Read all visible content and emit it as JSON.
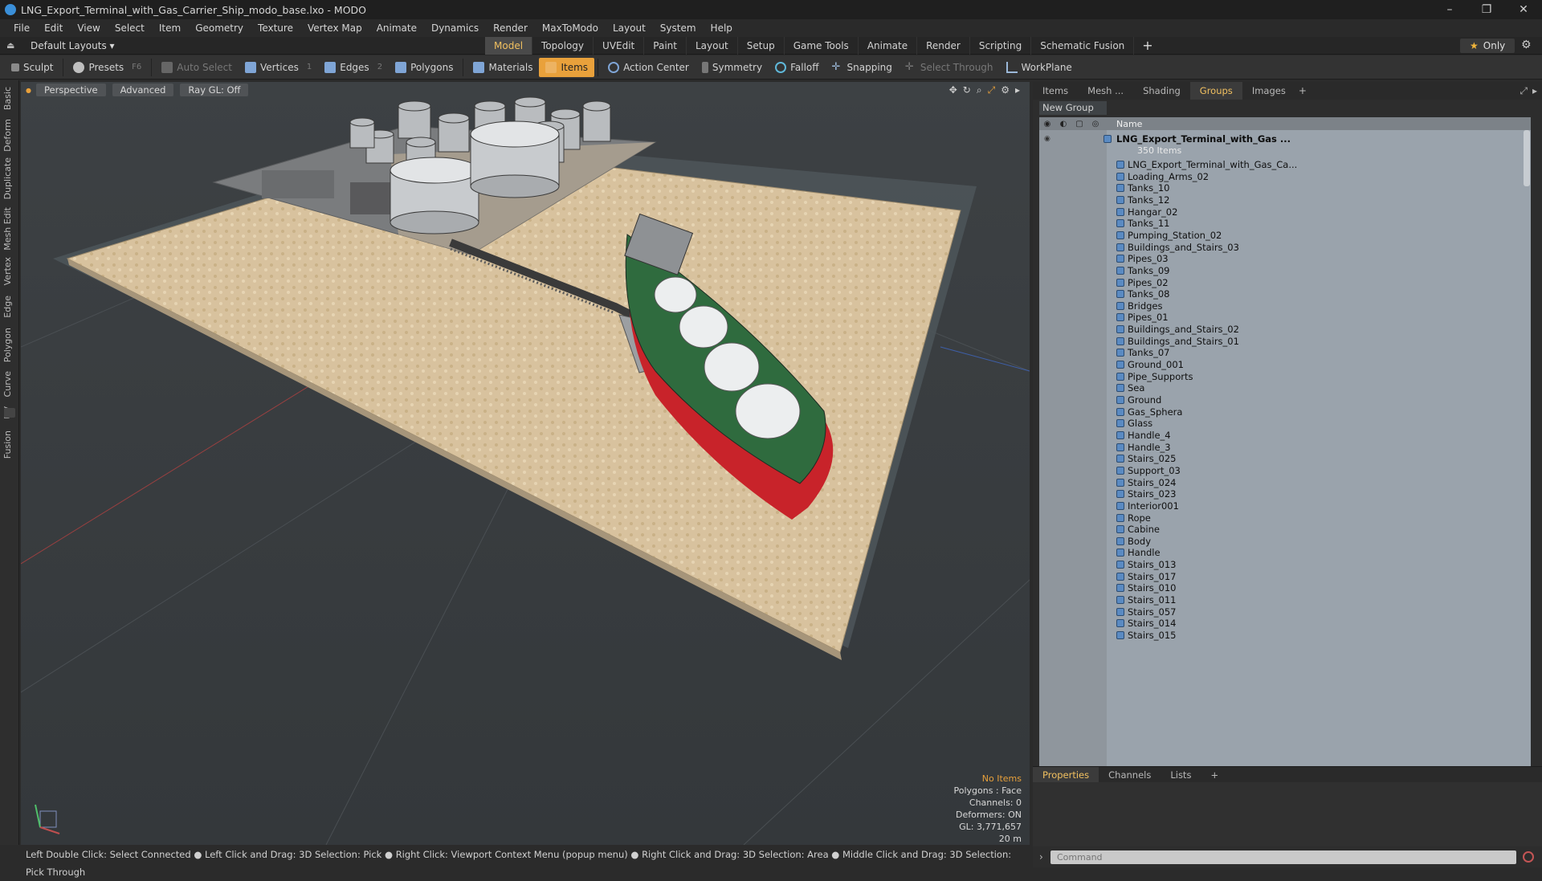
{
  "window": {
    "title": "LNG_Export_Terminal_with_Gas_Carrier_Ship_modo_base.lxo - MODO",
    "controls": [
      "–",
      "❐",
      "✕"
    ]
  },
  "menu": [
    "File",
    "Edit",
    "View",
    "Select",
    "Item",
    "Geometry",
    "Texture",
    "Vertex Map",
    "Animate",
    "Dynamics",
    "Render",
    "MaxToModo",
    "Layout",
    "System",
    "Help"
  ],
  "layout": {
    "dropdown": "Default Layouts ▾",
    "tabs": [
      "Model",
      "Topology",
      "UVEdit",
      "Paint",
      "Layout",
      "Setup",
      "Game Tools",
      "Animate",
      "Render",
      "Scripting",
      "Schematic Fusion"
    ],
    "active_tab": "Model",
    "plus": "+",
    "only_label": "Only"
  },
  "toolbar": {
    "sculpt": "Sculpt",
    "presets": "Presets",
    "presets_key": "F6",
    "auto_select": "Auto Select",
    "vertices": "Vertices",
    "vertices_key": "1",
    "edges": "Edges",
    "edges_key": "2",
    "polygons": "Polygons",
    "materials": "Materials",
    "items": "Items",
    "action_center": "Action Center",
    "symmetry": "Symmetry",
    "falloff": "Falloff",
    "snapping": "Snapping",
    "select_through": "Select Through",
    "workplane": "WorkPlane"
  },
  "left_tabs": [
    "Basic",
    "Deform",
    "Duplicate",
    "Mesh Edit",
    "Vertex",
    "Edge",
    "Polygon",
    "Curve",
    "UV",
    "Fusion"
  ],
  "viewport": {
    "perspective": "Perspective",
    "advanced": "Advanced",
    "raygl": "Ray GL: Off",
    "stats": {
      "no_items": "No Items",
      "polygons": "Polygons : Face",
      "channels": "Channels: 0",
      "deformers": "Deformers: ON",
      "gl": "GL: 3,771,657",
      "scale": "20 m"
    }
  },
  "statusbar": "Left Double Click: Select Connected ● Left Click and Drag: 3D Selection: Pick ● Right Click: Viewport Context Menu (popup menu) ● Right Click and Drag: 3D Selection: Area ● Middle Click and Drag: 3D Selection: Pick Through",
  "panel": {
    "tabs": [
      "Items",
      "Mesh ...",
      "Shading",
      "Groups",
      "Images"
    ],
    "active_tab": "Groups",
    "new_group": "New Group",
    "column_name": "Name",
    "root_label": "LNG_Export_Terminal_with_Gas ...",
    "root_count": "350 Items",
    "items": [
      "LNG_Export_Terminal_with_Gas_Ca...",
      "Loading_Arms_02",
      "Tanks_10",
      "Tanks_12",
      "Hangar_02",
      "Tanks_11",
      "Pumping_Station_02",
      "Buildings_and_Stairs_03",
      "Pipes_03",
      "Tanks_09",
      "Pipes_02",
      "Tanks_08",
      "Bridges",
      "Pipes_01",
      "Buildings_and_Stairs_02",
      "Buildings_and_Stairs_01",
      "Tanks_07",
      "Ground_001",
      "Pipe_Supports",
      "Sea",
      "Ground",
      "Gas_Sphera",
      "Glass",
      "Handle_4",
      "Handle_3",
      "Stairs_025",
      "Support_03",
      "Stairs_024",
      "Stairs_023",
      "Interior001",
      "Rope",
      "Cabine",
      "Body",
      "Handle",
      "Stairs_013",
      "Stairs_017",
      "Stairs_010",
      "Stairs_011",
      "Stairs_057",
      "Stairs_014",
      "Stairs_015"
    ],
    "props_tabs": [
      "Properties",
      "Channels",
      "Lists"
    ],
    "props_active": "Properties",
    "command_placeholder": "Command"
  },
  "colors": {
    "accent": "#e9a13b",
    "active_tab_text": "#f1c060",
    "hull_red": "#c8232a",
    "deck_green": "#2f6b3e",
    "ground_sand": "#d9c29c"
  }
}
